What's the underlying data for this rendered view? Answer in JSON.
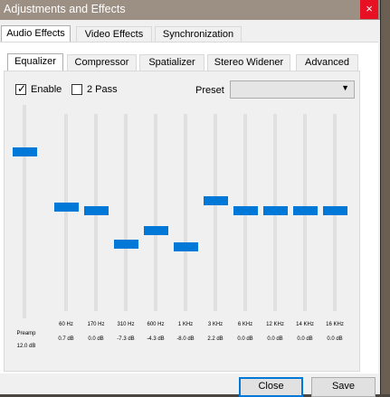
{
  "window": {
    "title": "Adjustments and Effects",
    "close_glyph": "×"
  },
  "main_tabs": [
    {
      "label": "Audio Effects",
      "active": true
    },
    {
      "label": "Video Effects",
      "active": false
    },
    {
      "label": "Synchronization",
      "active": false
    }
  ],
  "sub_tabs": [
    {
      "label": "Equalizer",
      "active": true
    },
    {
      "label": "Compressor",
      "active": false
    },
    {
      "label": "Spatializer",
      "active": false
    },
    {
      "label": "Stereo Widener",
      "active": false
    },
    {
      "label": "Advanced",
      "active": false
    }
  ],
  "equalizer": {
    "enable_label": "Enable",
    "enable_checked": true,
    "two_pass_label": "2 Pass",
    "two_pass_checked": false,
    "preset_label": "Preset",
    "preset_value": "",
    "gain_range_db": [
      -20,
      20
    ],
    "preamp": {
      "label": "Preamp",
      "value": "12.0 dB",
      "db": 12.0
    },
    "bands": [
      {
        "freq": "60 Hz",
        "value": "0.7 dB",
        "db": 0.7
      },
      {
        "freq": "170 Hz",
        "value": "0.0 dB",
        "db": 0.0
      },
      {
        "freq": "310 Hz",
        "value": "-7.3 dB",
        "db": -7.3
      },
      {
        "freq": "600 Hz",
        "value": "-4.3 dB",
        "db": -4.3
      },
      {
        "freq": "1 KHz",
        "value": "-8.0 dB",
        "db": -8.0
      },
      {
        "freq": "3 KHz",
        "value": "2.2 dB",
        "db": 2.2
      },
      {
        "freq": "6 KHz",
        "value": "0.0 dB",
        "db": 0.0
      },
      {
        "freq": "12 KHz",
        "value": "0.0 dB",
        "db": 0.0
      },
      {
        "freq": "14 KHz",
        "value": "0.0 dB",
        "db": 0.0
      },
      {
        "freq": "16 KHz",
        "value": "0.0 dB",
        "db": 0.0
      }
    ]
  },
  "buttons": {
    "close": "Close",
    "save": "Save"
  },
  "colors": {
    "accent": "#0078d7",
    "title_bar": "#9c8f84",
    "close_red": "#e81123"
  }
}
